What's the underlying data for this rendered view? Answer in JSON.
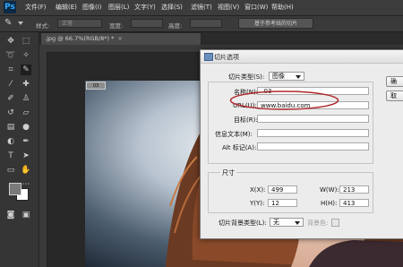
{
  "app": {
    "logo": "Ps"
  },
  "menu": [
    "文件(F)",
    "编辑(E)",
    "图像(I)",
    "图层(L)",
    "文字(Y)",
    "选择(S)",
    "滤镜(T)",
    "视图(V)",
    "窗口(W)",
    "帮助(H)"
  ],
  "options_bar": {
    "style_label": "样式:",
    "style_value": "正常",
    "width_label": "宽度:",
    "height_label": "高度:",
    "guides_button": "基于参考线的切片"
  },
  "document_tab": {
    "title": ".jpg @ 66.7%(RGB/8*) *",
    "close": "×"
  },
  "slice_badge": "03",
  "dialog": {
    "title": "切片选项",
    "slice_type_label": "切片类型(S):",
    "slice_type_value": "图像",
    "name_label": "名称(N):",
    "name_value": "_03",
    "url_label": "URL(U):",
    "url_value": "www.baidu.com",
    "target_label": "目标(R):",
    "target_value": "",
    "message_label": "信息文本(M):",
    "message_value": "",
    "alt_label": "Alt 标记(A):",
    "alt_value": "",
    "dimensions_title": "尺寸",
    "x_label": "X(X):",
    "x_value": "499",
    "y_label": "Y(Y):",
    "y_value": "12",
    "w_label": "W(W):",
    "w_value": "213",
    "h_label": "H(H):",
    "h_value": "413",
    "bg_type_label": "切片背景类型(L):",
    "bg_type_value": "无",
    "bg_color_label": "背景色:",
    "ok_button": "确",
    "cancel_button": "取"
  },
  "colors": {
    "annotation": "#b0282a",
    "accent": "#37a8ff",
    "foreground_swatch": "#7a7a7a",
    "background_swatch": "#ffffff"
  }
}
